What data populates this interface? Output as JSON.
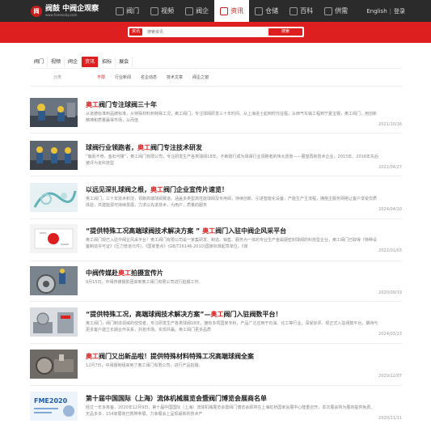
{
  "topbar": {
    "logo_badge": "阀",
    "logo_main": "阀鼓 中阀企观察",
    "logo_sub": "www.famensky.com",
    "nav": [
      {
        "label": "阀门",
        "icon": "valve-icon"
      },
      {
        "label": "视频",
        "icon": "video-icon"
      },
      {
        "label": "阀企",
        "icon": "company-icon"
      },
      {
        "label": "资讯",
        "icon": "news-icon",
        "active": true
      },
      {
        "label": "仓储",
        "icon": "warehouse-icon"
      },
      {
        "label": "百科",
        "icon": "encyclopedia-icon"
      },
      {
        "label": "供需",
        "icon": "supply-icon"
      }
    ],
    "language": "English",
    "login": "登录"
  },
  "search": {
    "tag": "资讯",
    "placeholder": "搜索资讯",
    "button": "搜索"
  },
  "categories": {
    "tabs": [
      "阀门",
      "视频",
      "阀企",
      "资讯",
      "招标",
      "展会"
    ],
    "active_tab": "资讯",
    "filter_label": "分类",
    "filters": [
      "不限",
      "行业新闻",
      "名企动态",
      "技术文章",
      "阀企之窗"
    ],
    "active_filter": "不限"
  },
  "articles": [
    {
      "title_pre": "",
      "title_hl": "奥工",
      "title_post": "阀门专注球阀三十年",
      "snippet": "从道德标准到品牌标准，从特殊材料到特殊工况，奥工阀门，专注球阀研发三十年时间。从上海进士起到时代征程，从西气东输工程到宁夏宝钢，奥工阀门，用创新精神和质量赢得市场，从而值",
      "date": "2021/10/16"
    },
    {
      "title_pre": "球阀行业领跑者，",
      "title_hl": "奥工",
      "title_post": "阀门专注技术研发",
      "snippet": "“偏而不奇，金石可镂”，奥工阀门有限公司，专注研发生产各类球阀18年，不断践行成为球阀行业领跑者的伟大愿景——展望再新技术企业，2015年、2016年先后被评为省科技型",
      "date": "2022/04/27"
    },
    {
      "title_pre": "以远见深扎球阀之根，",
      "title_hl": "奥工",
      "title_post": "阀门企业宣传片速览！",
      "snippet": "奥工阀门，三十年技术积淀，领跑高端球阀赛道。涵盖多类型高性能球阀及专用阀，持续创新、引进智能化设备，产能生产主流程，拥抱主服务网络让客户享受优质体验，共建能源可持续发展，力求以先进技术，为用户，质量的服务",
      "date": "2024/04/10"
    },
    {
      "title_pre": "“提供特殊工况高端球阀技术解决方案 ”  ",
      "title_hl": "奥工",
      "title_post": "阀门入驻中阀企风采平台",
      "snippet": "奥工阀门现已入驻中阀企风采平台！奥工阀门有限公司是一家集研发、制造、销售、服务为一体的专业生产金属硬密封球阀的科技型企业，奥工阀门已取得《特种设备制造许可证》(压力管道元件)，《国家重点》(GB/T26146-2010)国家标准起草单位。《煤",
      "date": "2022/01/03"
    },
    {
      "title_pre": "中阀传媒赴",
      "title_hl": "奥工",
      "title_post": "拍摄宣传片",
      "snippet": "9月15日，中阀传媒摄影团来到奥工阀门有限公司进行拍摄工作。",
      "date": "2020/09/19"
    },
    {
      "title_pre": "“提供特殊工况，高端球阀技术解决方案”—",
      "title_hl": "奥工",
      "title_post": "阀门入驻阀数平台！",
      "snippet": "奥工阀门，阀门制造领域的佼佼者，专注研发生产各类球阀18年，拥有多项国家专利，产品广泛应用于石油、化工等行业，深受好评。现正式入驻阀数平台，期待与更多客户建立长期合作关系，共拓市场。实现共赢。奥工阀门更多品质",
      "date": "2024/03/23"
    },
    {
      "title_pre": "",
      "title_hl": "奥工",
      "title_post": "阀门又出新品啦！提供特殊材料特殊工况高端球阀全案",
      "snippet": "12月7日，中阀摄制组来到了奥工阀门有限公司，进行产品拍摄。",
      "date": "2020/12/07"
    },
    {
      "title_pre": "第十届中国国际（上海）流体机械展览会暨阀门博览会展商名单",
      "title_hl": "",
      "title_post": "",
      "snippet": "经过一年多筹备，2020年12月9日，第十届中国国际（上海）流体机械展览会暨阀门博览会即将在上海虹桥国家会展中心隆重召开。本次展会将为展商提供免费、无品多多、154家展商已携带参展，力争展会上呈现最新的技术产",
      "date": "2020/11/11"
    }
  ]
}
